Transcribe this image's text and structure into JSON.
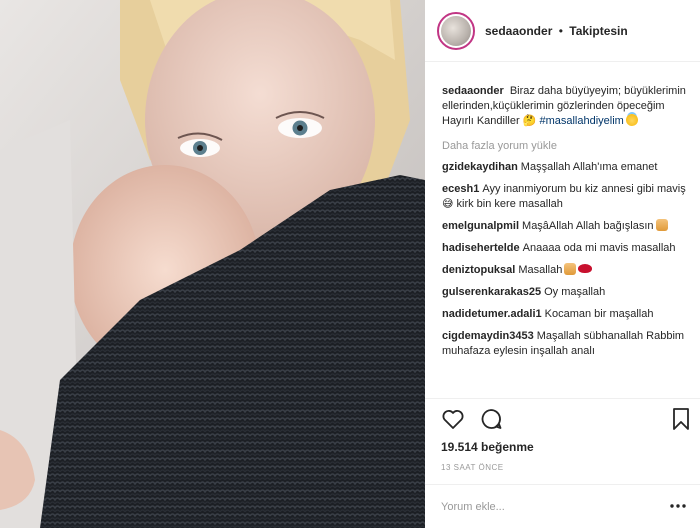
{
  "photo": {
    "alt_icon": "photo-mother-baby"
  },
  "header": {
    "username": "sedaaonder",
    "separator": "•",
    "follow_status": "Takiptesin"
  },
  "caption": {
    "username": "sedaaonder",
    "text": "Biraz daha büyüyeyim; büyüklerimin ellerinden,küçüklerimin gözlerinden öpeceğim Hayırlı Kandiller",
    "suffix": "🤔 ",
    "hashtag": "#masallahdiyelim"
  },
  "load_more": "Daha fazla yorum yükle",
  "comments": [
    {
      "username": "gzidekaydihan",
      "text": "Maşşallah Allah'ıma emanet",
      "emoji": ""
    },
    {
      "username": "ecesh1",
      "text": "Ayy inanmiyorum bu kiz annesi gibi maviş 😅 kirk bin kere masallah",
      "emoji": ""
    },
    {
      "username": "emelgunalpmil",
      "text": "MaşâAllah Allah bağışlasın",
      "emoji": "pray"
    },
    {
      "username": "hadisehertelde",
      "text": "Anaaaa oda mi mavis masallah",
      "emoji": ""
    },
    {
      "username": "deniztopuksal",
      "text": "Masallah",
      "emoji": "pray-lips"
    },
    {
      "username": "gulserenkarakas25",
      "text": "Oy maşallah",
      "emoji": ""
    },
    {
      "username": "nadidetumer.adali1",
      "text": "Kocaman bir maşallah",
      "emoji": ""
    },
    {
      "username": "cigdemaydin3453",
      "text": "Maşallah sübhanallah Rabbim muhafaza eylesin inşallah analı",
      "emoji": ""
    }
  ],
  "actions": {
    "like_icon": "heart-icon",
    "comment_icon": "comment-icon",
    "save_icon": "bookmark-icon"
  },
  "likes": {
    "count": "19.514",
    "label": "beğenme"
  },
  "timestamp": "13 SAAT ÖNCE",
  "add_comment": {
    "placeholder": "Yorum ekle..."
  },
  "colors": {
    "accent": "#003569",
    "muted": "#999999",
    "text": "#262626"
  }
}
